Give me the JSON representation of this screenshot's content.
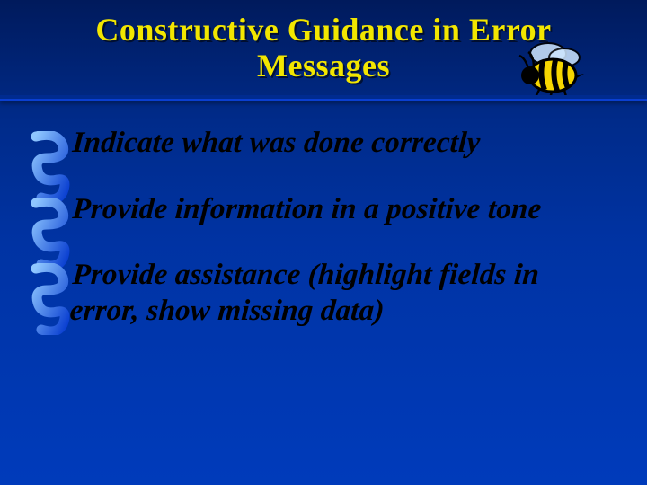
{
  "title": "Constructive Guidance in Error Messages",
  "bullets": [
    "Indicate what was done correctly",
    "Provide information in a positive tone",
    "Provide assistance (highlight fields in error, show missing data)"
  ],
  "colors": {
    "title": "#f2e600",
    "background_top": "#001a5c",
    "background_bottom": "#003bbb",
    "spiral_light": "#5aa7f0",
    "spiral_dark": "#0a3fd1"
  },
  "decorations": {
    "bee_icon": "bee-clipart",
    "bullet_icon": "blue-spiral-ribbon"
  }
}
